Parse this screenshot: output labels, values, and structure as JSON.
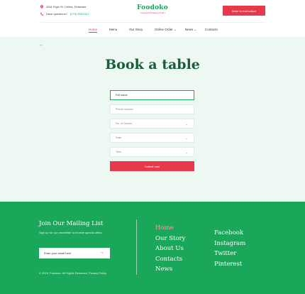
{
  "header": {
    "address": "3261 Elgin St. Celina, Delaware",
    "phone_label": "Have questions?",
    "phone_number": "(270) 555-0117",
    "logo_name": "Foodoko",
    "logo_tagline": "• Fast and Delicious Food •",
    "reserve_label": "Make a reservation"
  },
  "nav": {
    "items": [
      {
        "label": "Home"
      },
      {
        "label": "Menu"
      },
      {
        "label": "Our Story"
      },
      {
        "label": "Online Order ⌄"
      },
      {
        "label": "News ⌄"
      },
      {
        "label": "Contacts"
      }
    ]
  },
  "booking": {
    "back_icon": "←",
    "title": "Book a table",
    "full_name_placeholder": "Full name",
    "phone_placeholder": "Phone number",
    "guests_placeholder": "No. of Guests",
    "date_placeholder": "Date",
    "time_placeholder": "Time",
    "submit_label": "Submit now"
  },
  "footer": {
    "mailing_title": "Join Our Mailing List",
    "mailing_sub": "Sign up for our newsletter to receive special offers.",
    "email_placeholder": "Enter your email here",
    "copyright": "© 2020, Foodoko.  All Rights Reserved.  Privacy Policy",
    "links1": [
      "Home",
      "Our Story",
      "About Us",
      "Contacts",
      "News"
    ],
    "links2": [
      "Facebook",
      "Instagram",
      "Twitter",
      "Pinterest"
    ]
  },
  "colors": {
    "accent": "#e8394a",
    "brand_green": "#1aa75a",
    "hero_bg": "#eef8f2"
  }
}
